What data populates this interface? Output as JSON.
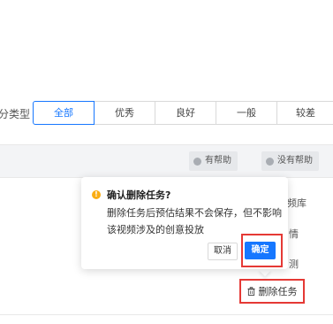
{
  "filter": {
    "label": "分类型",
    "options": [
      "全部",
      "优秀",
      "良好",
      "一般",
      "较差"
    ],
    "selected": "全部"
  },
  "help_bar": {
    "helpful_label": "有帮助",
    "not_helpful_label": "没有帮助"
  },
  "side_actions": {
    "item1": "频库",
    "item2": "情",
    "item3": "测",
    "delete_task_label": "删除任务"
  },
  "confirm_popover": {
    "title": "确认删除任务?",
    "description": "删除任务后预估结果不会保存，但不影响该视频涉及的创意投放",
    "cancel_label": "取消",
    "ok_label": "确定"
  },
  "colors": {
    "primary": "#1677ff",
    "warning": "#faad14",
    "highlight_frame": "#e53935"
  }
}
